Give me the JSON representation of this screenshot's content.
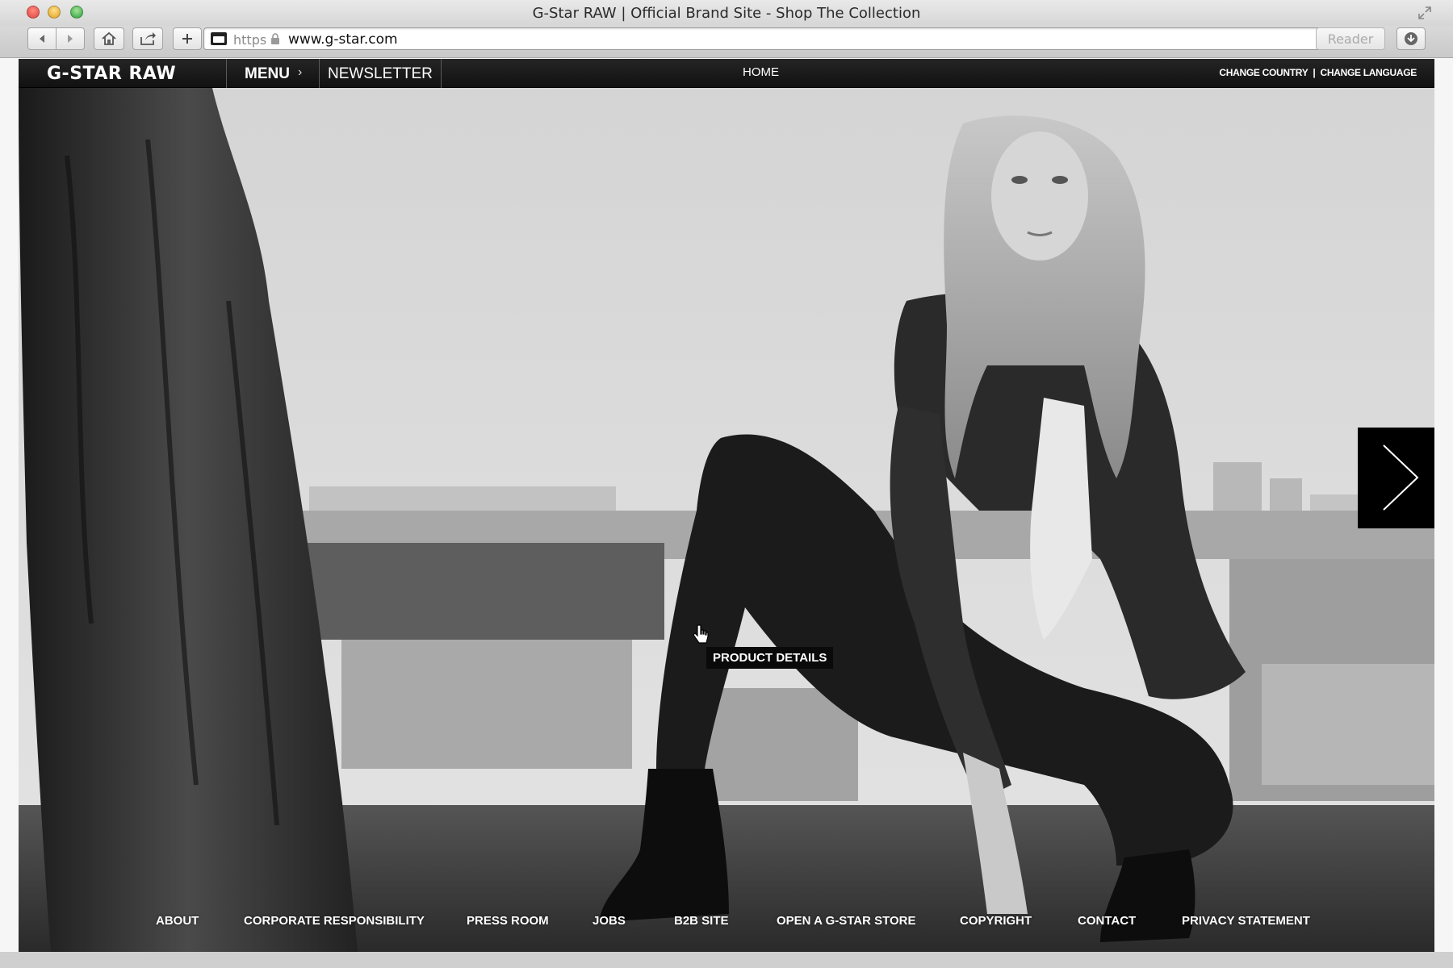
{
  "window": {
    "title": "G-Star RAW | Official Brand Site - Shop The Collection"
  },
  "toolbar": {
    "url_scheme": "https",
    "url": "www.g-star.com",
    "reader_label": "Reader"
  },
  "site_nav": {
    "logo": "G-STAR RAW",
    "menu_label": "MENU",
    "newsletter_label": "NEWSLETTER",
    "home_label": "HOME",
    "change_country_label": "CHANGE COUNTRY",
    "separator": "|",
    "change_language_label": "CHANGE LANGUAGE"
  },
  "hero": {
    "product_tooltip": "PRODUCT DETAILS"
  },
  "footer": {
    "links": [
      "ABOUT",
      "CORPORATE RESPONSIBILITY",
      "PRESS ROOM",
      "JOBS",
      "B2B SITE",
      "OPEN A G-STAR STORE",
      "COPYRIGHT",
      "CONTACT",
      "PRIVACY STATEMENT"
    ]
  },
  "colors": {
    "nav_background": "#1a1a1a",
    "text": "#ffffff",
    "arrow_box": "#000000"
  }
}
